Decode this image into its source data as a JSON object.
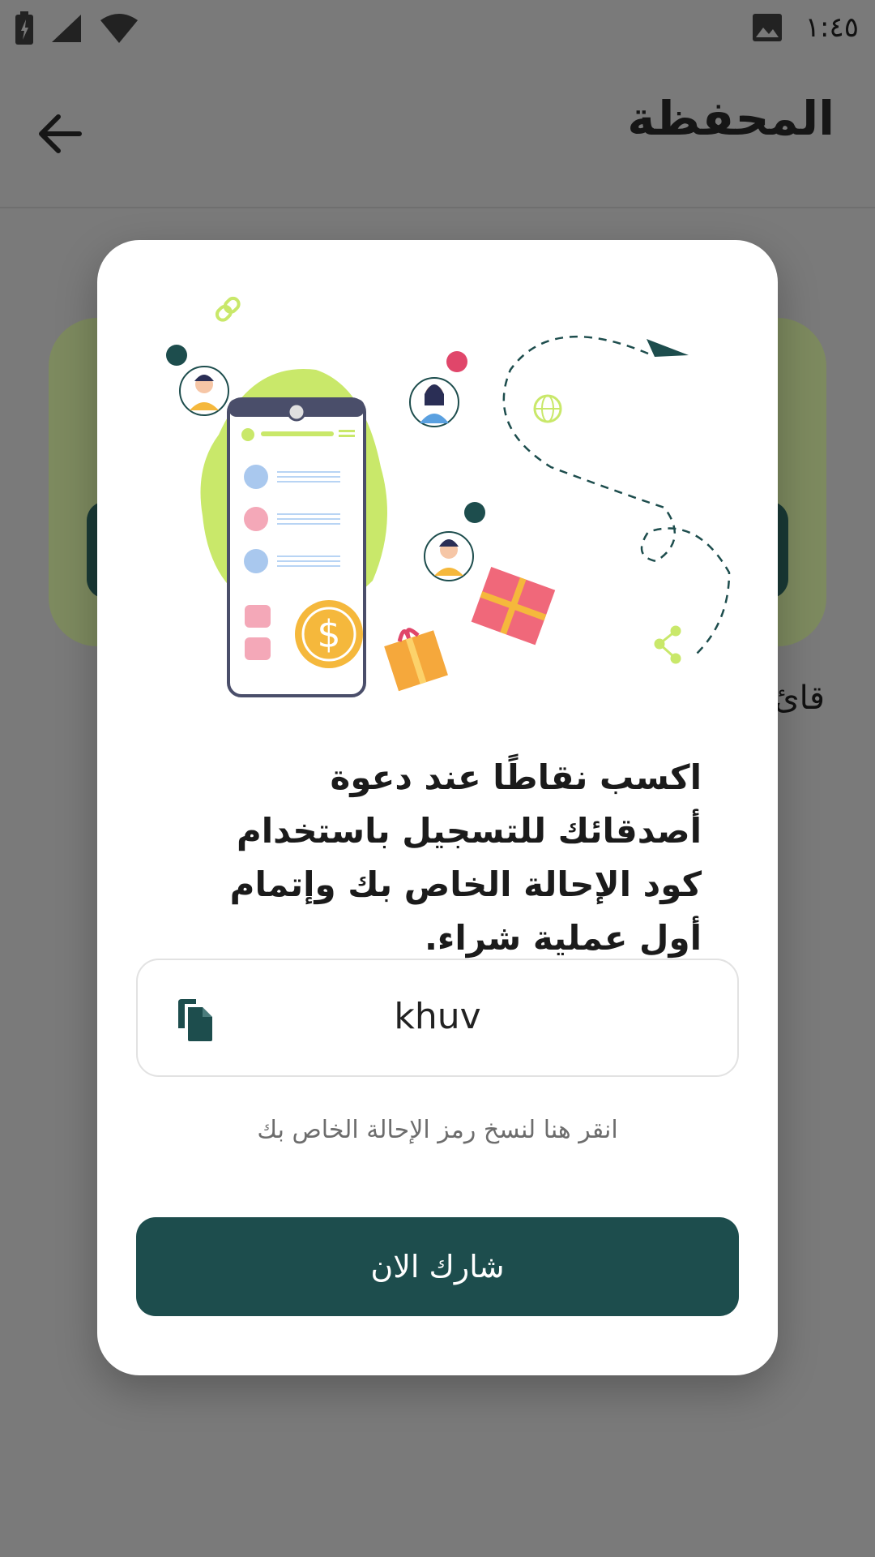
{
  "status_bar": {
    "time": "١:٤٥"
  },
  "app_bar": {
    "title": "المحفظة"
  },
  "background": {
    "label_partial": "قائ"
  },
  "modal": {
    "message": "اكسب نقاطًا عند دعوة أصدقائك للتسجيل باستخدام كود الإحالة الخاص بك وإتمام أول عملية شراء.",
    "referral_code": "khuv",
    "copy_hint": "انقر هنا لنسخ رمز الإحالة الخاص بك",
    "share_button": "شارك الان"
  },
  "colors": {
    "primary": "#1d4d4d",
    "accent_green": "#c9e86a",
    "overlay": "#7a7a7a"
  },
  "icons": [
    "battery-icon",
    "signal-icon",
    "wifi-icon",
    "image-icon",
    "back-arrow-icon",
    "copy-icon"
  ]
}
